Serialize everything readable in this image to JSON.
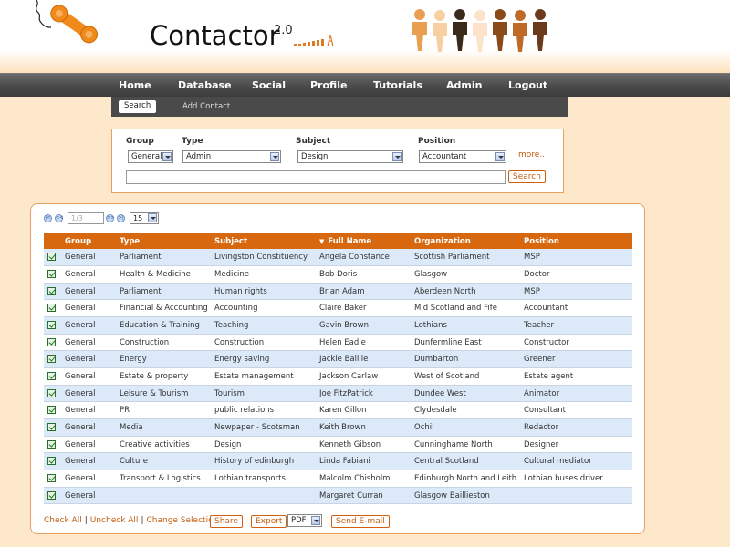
{
  "brand": {
    "name": "Contactor",
    "version": "2.0"
  },
  "nav": {
    "items": [
      "Home",
      "Database",
      "Social",
      "Profile",
      "Tutorials",
      "Admin",
      "Logout"
    ]
  },
  "subnav": {
    "search": "Search",
    "add_contact": "Add Contact"
  },
  "filter": {
    "group_label": "Group",
    "group_value": "General",
    "type_label": "Type",
    "type_value": "Admin",
    "subject_label": "Subject",
    "subject_value": "Design",
    "position_label": "Position",
    "position_value": "Accountant",
    "more": "more..",
    "search_button": "Search"
  },
  "pager": {
    "page_placeholder": "1/3",
    "page_size": "15"
  },
  "table": {
    "columns": [
      "Group",
      "Type",
      "Subject",
      "Full Name",
      "Organization",
      "Position"
    ],
    "sort_column": "Full Name",
    "rows": [
      [
        "General",
        "Parliament",
        "Livingston Constituency",
        "Angela Constance",
        "Scottish Parliament",
        "MSP"
      ],
      [
        "General",
        "Health & Medicine",
        "Medicine",
        "Bob Doris",
        "Glasgow",
        "Doctor"
      ],
      [
        "General",
        "Parliament",
        "Human rights",
        "Brian Adam",
        "Aberdeen North",
        "MSP"
      ],
      [
        "General",
        "Financial & Accounting",
        "Accounting",
        "Claire Baker",
        "Mid Scotland and Fife",
        "Accountant"
      ],
      [
        "General",
        "Education & Training",
        "Teaching",
        "Gavin Brown",
        "Lothians",
        "Teacher"
      ],
      [
        "General",
        "Construction",
        "Construction",
        "Helen Eadie",
        "Dunfermline East",
        "Constructor"
      ],
      [
        "General",
        "Energy",
        "Energy saving",
        "Jackie Baillie",
        "Dumbarton",
        "Greener"
      ],
      [
        "General",
        "Estate & property",
        "Estate management",
        "Jackson Carlaw",
        "West of Scotland",
        "Estate agent"
      ],
      [
        "General",
        "Leisure & Tourism",
        "Tourism",
        "Joe FitzPatrick",
        "Dundee West",
        "Animator"
      ],
      [
        "General",
        "PR",
        "public relations",
        "Karen Gillon",
        "Clydesdale",
        "Consultant"
      ],
      [
        "General",
        "Media",
        "Newpaper - Scotsman",
        "Keith Brown",
        "Ochil",
        "Redactor"
      ],
      [
        "General",
        "Creative activities",
        "Design",
        "Kenneth Gibson",
        "Cunninghame North",
        "Designer"
      ],
      [
        "General",
        "Culture",
        "History of edinburgh",
        "Linda Fabiani",
        "Central Scotland",
        "Cultural mediator"
      ],
      [
        "General",
        "Transport & Logistics",
        "Lothian transports",
        "Malcolm Chisholm",
        "Edinburgh North and Leith",
        "Lothian buses driver"
      ],
      [
        "General",
        "",
        "",
        "Margaret Curran",
        "Glasgow Baillieston",
        ""
      ]
    ]
  },
  "footer": {
    "check_all": "Check All",
    "uncheck_all": "Uncheck All",
    "change_selection": "Change Selection",
    "share": "Share",
    "export": "Export",
    "format": "PDF",
    "send_email": "Send E-mail"
  },
  "colors": {
    "accent": "#d8680f",
    "background": "#fde8cc",
    "row_alt": "#dbe9f9",
    "nav": "#4a4a4a"
  }
}
